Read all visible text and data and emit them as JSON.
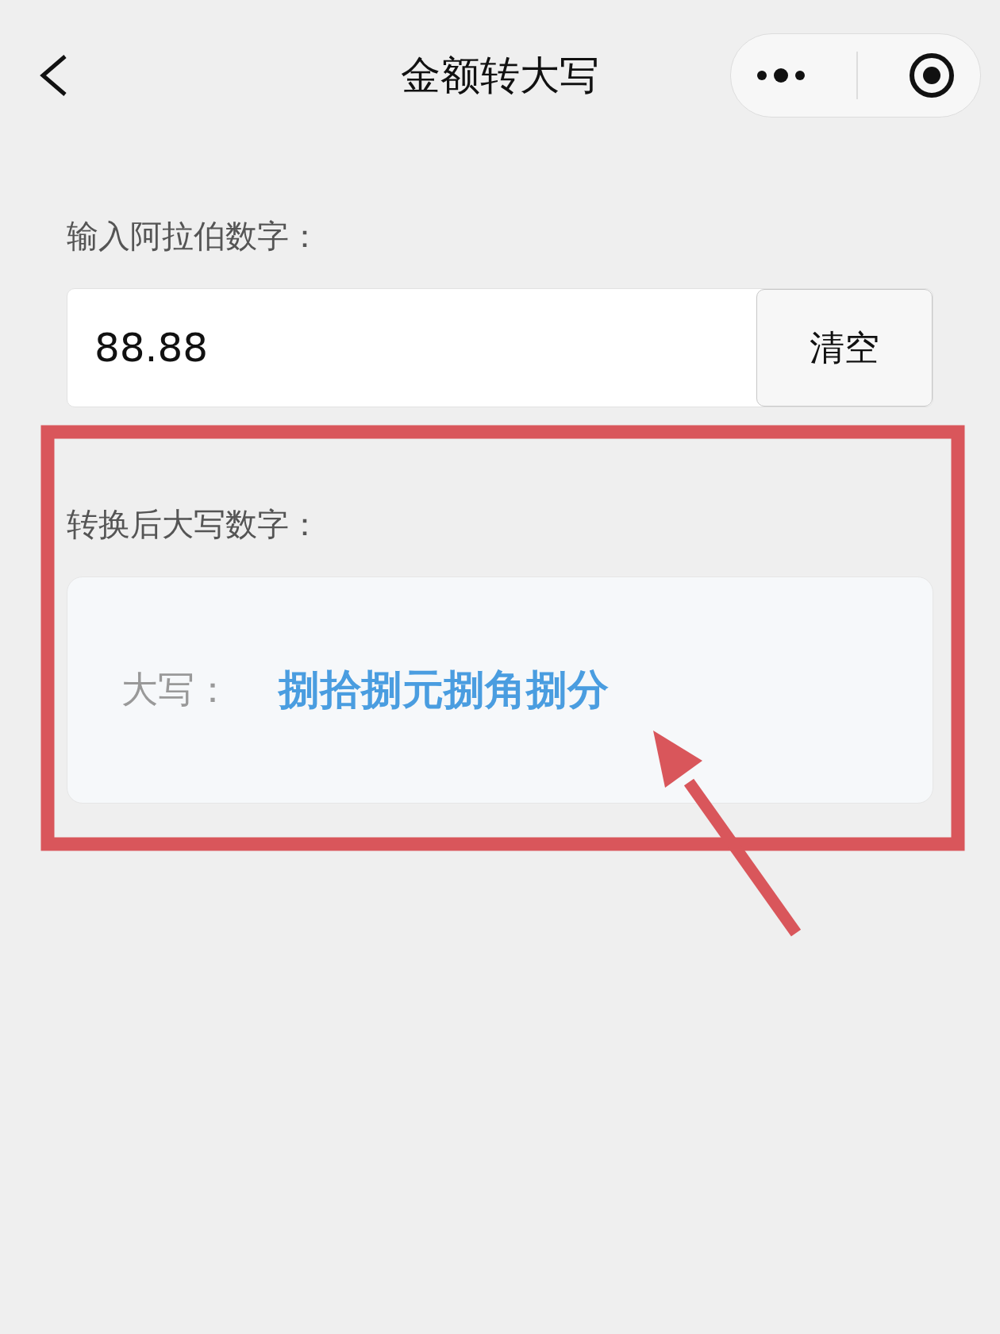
{
  "nav_bar": {
    "title": "金额转大写"
  },
  "input_section": {
    "label": "输入阿拉伯数字：",
    "value": "88.88",
    "clear_button": "清空"
  },
  "result_section": {
    "label": "转换后大写数字：",
    "result_label": "大写：",
    "result_value": "捌拾捌元捌角捌分"
  }
}
